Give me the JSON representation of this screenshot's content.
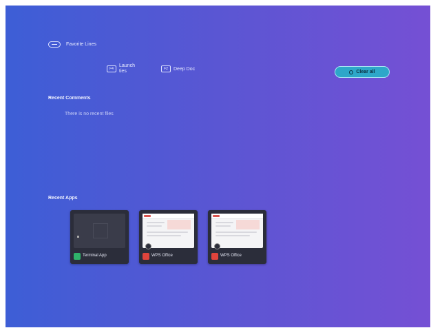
{
  "favorites": {
    "title": "Favorite Lines",
    "items": [
      {
        "icon_text": "F4",
        "label": "Launch\nties"
      },
      {
        "icon_text": "F2",
        "label": "Deep Doc"
      }
    ],
    "clear_label": "Clear all"
  },
  "comments": {
    "title": "Recent Comments",
    "empty_text": "There is no recent files"
  },
  "apps": {
    "title": "Recent Apps",
    "items": [
      {
        "label": "Terminal App",
        "icon": "terminal-icon",
        "color": "#2fb36a"
      },
      {
        "label": "WPS Office",
        "icon": "wps-office-icon",
        "color": "#e0443c"
      },
      {
        "label": "WPS Office",
        "icon": "wps-office-icon",
        "color": "#e0443c"
      }
    ]
  },
  "colors": {
    "gradient_start": "#3d5ed6",
    "gradient_end": "#7550d4",
    "accent_pill": "#2ea7c9"
  }
}
